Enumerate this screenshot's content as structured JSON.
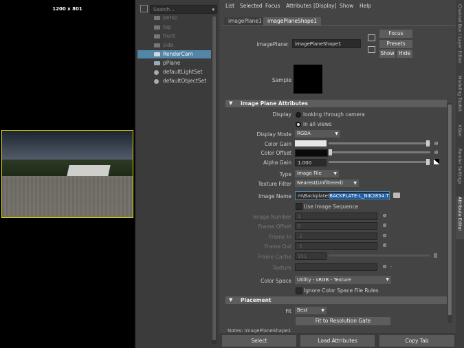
{
  "viewport": {
    "resolution_label": "1200 x 801"
  },
  "outliner": {
    "search_placeholder": "Search...",
    "items": [
      {
        "label": "persp",
        "state": "dim"
      },
      {
        "label": "top",
        "state": "dim"
      },
      {
        "label": "front",
        "state": "dim"
      },
      {
        "label": "side",
        "state": "dim"
      },
      {
        "label": "RenderCam",
        "state": "selected"
      },
      {
        "label": "pPlane",
        "state": "normal"
      },
      {
        "label": "defaultLightSet",
        "state": "normal"
      },
      {
        "label": "defaultObjectSet",
        "state": "normal"
      }
    ]
  },
  "menu": {
    "list": "List",
    "selected": "Selected",
    "focus": "Focus",
    "attributes": "Attributes",
    "display": "[Display]",
    "show": "Show",
    "help": "Help"
  },
  "tabs": {
    "tab1": "imagePlane1",
    "tab2": "imagePlaneShape1"
  },
  "header": {
    "imageplane_label": "imagePlane:",
    "imageplane_value": "imagePlaneShape1",
    "focus_btn": "Focus",
    "presets_btn": "Presets",
    "show_btn": "Show",
    "hide_btn": "Hide",
    "sample_label": "Sample"
  },
  "image_plane_attrs": {
    "section_title": "Image Plane Attributes",
    "display_label": "Display",
    "display_opt1": "looking through camera",
    "display_opt2": "in all views",
    "display_mode_label": "Display Mode",
    "display_mode_value": "RGBA",
    "color_gain_label": "Color Gain",
    "color_offset_label": "Color Offset",
    "alpha_gain_label": "Alpha Gain",
    "alpha_gain_value": "1.000",
    "type_label": "Type",
    "type_value": "Image File",
    "texture_filter_label": "Texture Filter",
    "texture_filter_value": "Nearest(Unfiltered)",
    "image_name_label": "Image Name",
    "image_name_prefix": "m\\Backplate\\",
    "image_name_selected": "BACKPLATE-L_NIK2854.TIF",
    "use_sequence_label": "Use Image Sequence",
    "image_number_label": "Image Number",
    "image_number_value": "1",
    "frame_offset_label": "Frame Offset",
    "frame_offset_value": "0",
    "frame_in_label": "Frame In",
    "frame_in_value": "-1",
    "frame_out_label": "Frame Out",
    "frame_out_value": "-1",
    "frame_cache_label": "Frame Cache",
    "frame_cache_value": "151",
    "texture_label": "Texture",
    "color_space_label": "Color Space",
    "color_space_value": "Utility - sRGB - Texture",
    "ignore_cs_label": "Ignore Color Space File Rules"
  },
  "placement": {
    "section_title": "Placement",
    "fit_label": "Fit",
    "fit_value": "Best",
    "fit_resolution_btn": "Fit to Resolution Gate"
  },
  "notes": {
    "label": "Notes:  imagePlaneShape1"
  },
  "bottom": {
    "select": "Select",
    "load": "Load Attributes",
    "copy": "Copy Tab"
  },
  "vtabs": [
    "Channel Box / Layer Editor",
    "Modeling Toolkit",
    "XGen",
    "Render Settings",
    "Attribute Editor"
  ],
  "colors": {
    "selection": "#5285a6",
    "display_menu": "#57e057",
    "highlight_text": "#1e5fa8"
  }
}
